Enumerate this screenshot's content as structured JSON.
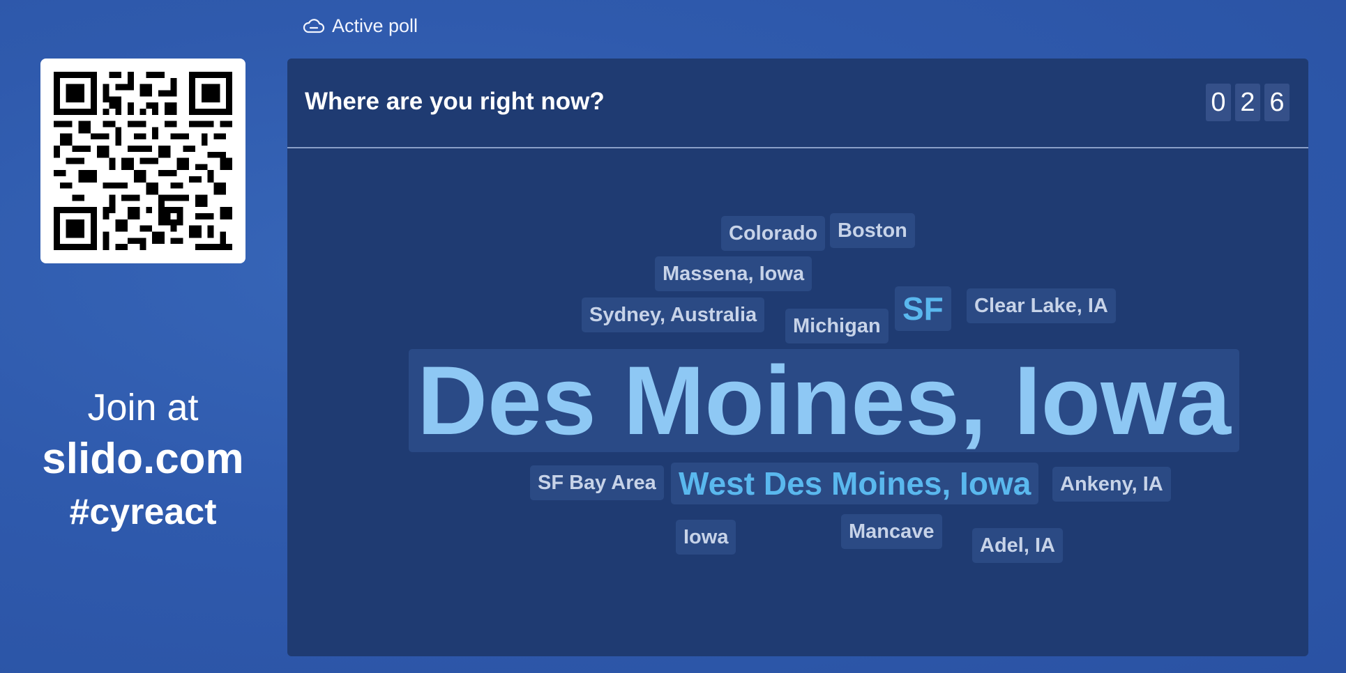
{
  "sidebar": {
    "join_label": "Join at",
    "site": "slido.com",
    "event_code": "#cyreact",
    "qr_icon": "qr-code-icon"
  },
  "status": {
    "icon": "cloud-icon",
    "label": "Active poll"
  },
  "poll": {
    "question": "Where are you right now?",
    "response_count_digits": [
      "0",
      "2",
      "6"
    ]
  },
  "word_cloud": {
    "words": [
      "Colorado",
      "Boston",
      "Massena, Iowa",
      "Sydney, Australia",
      "Michigan",
      "SF",
      "Clear Lake, IA",
      "Des Moines, Iowa",
      "SF Bay Area",
      "West Des Moines, Iowa",
      "Ankeny, IA",
      "Iowa",
      "Mancave",
      "Adel, IA"
    ]
  },
  "colors": {
    "background": "#2f5aad",
    "panel": "#1f3b72",
    "word_tile": "#2b4a84",
    "highlight_large": "#8ec8f4",
    "highlight_medium": "#5ab8ee",
    "word_default": "#c7d3e8"
  }
}
